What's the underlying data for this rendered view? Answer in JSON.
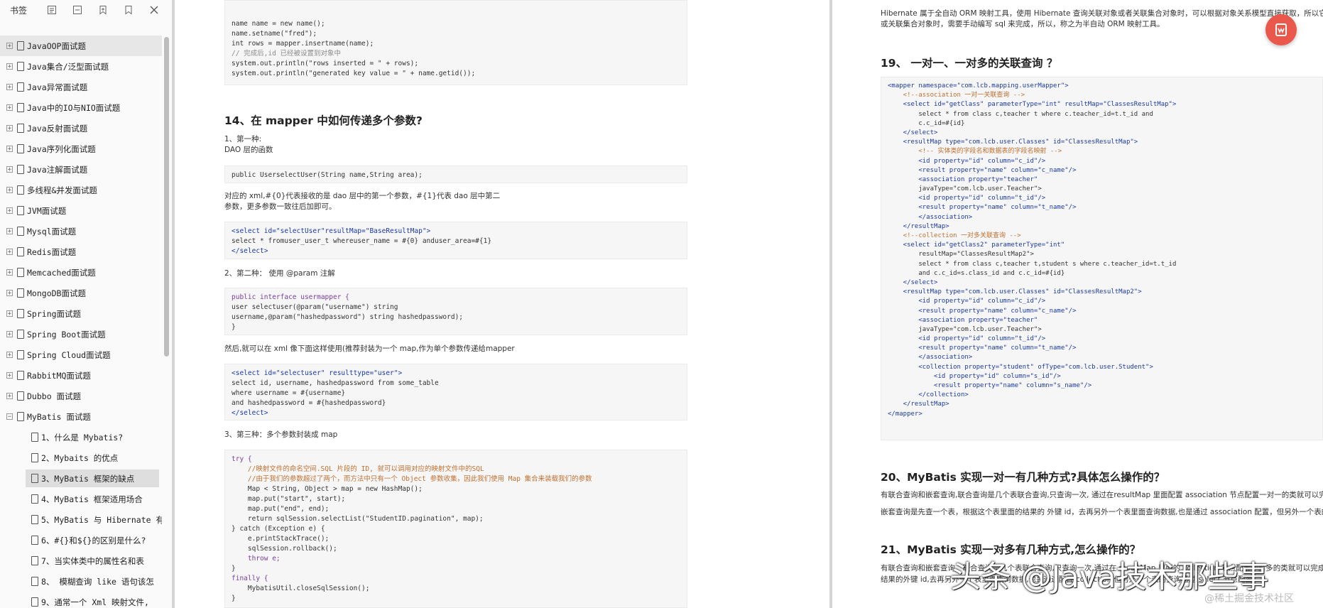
{
  "sidebar": {
    "title": "书签",
    "bookmarks": [
      "JavaOOP面试题",
      "Java集合/泛型面试题",
      "Java异常面试题",
      "Java中的IO与NIO面试题",
      "Java反射面试题",
      "Java序列化面试题",
      "Java注解面试题",
      "多线程&并发面试题",
      "JVM面试题",
      "Mysql面试题",
      "Redis面试题",
      "Memcached面试题",
      "MongoDB面试题",
      "Spring面试题",
      "Spring Boot面试题",
      "Spring Cloud面试题",
      "RabbitMQ面试题",
      "Dubbo 面试题",
      "MyBatis 面试题"
    ],
    "children": [
      "1、什么是 Mybatis?",
      "2、Mybaits 的优点",
      "3、MyBatis 框架的缺点",
      "4、MyBatis 框架适用场合",
      "5、MyBatis 与 Hibernate 有",
      "6、#{}和${}的区别是什么?",
      "7、当实体类中的属性名和表",
      "8、 模糊查询 like 语句该怎",
      "9、通常一个 Xml 映射文件,"
    ]
  },
  "page1": {
    "code_top": [
      "name name = new name();",
      "name.setname(\"fred\");",
      "int rows = mapper.insertname(name);",
      "// 完成后,id 已经被设置到对象中",
      "system.out.println(\"rows inserted = \" + rows);",
      "system.out.println(\"generated key value = \" + name.getid());"
    ],
    "heading14": "14、在 mapper 中如何传递多个参数?",
    "p_first": "1、第一种:",
    "p_dao": "DAO 层的函数",
    "code_dao": "public UserselectUser(String name,String area);",
    "p_explain1": "对应的 xml,#{0}代表接收的是 dao 层中的第一个参数，#{1}代表 dao 层中第二",
    "p_explain2": "参数，更多参数一致往后加即可。",
    "code_select1": [
      "<select id=\"selectUser\"resultMap=\"BaseResultMap\">",
      "select * fromuser_user_t whereuser_name = #{0} anduser_area=#{1}",
      "</select>"
    ],
    "p_second": "2、第二种： 使用 @param 注解",
    "code_interface": [
      "public interface usermapper {",
      "user selectuser(@param(\"username\") string",
      "username,@param(\"hashedpassword\") string hashedpassword);",
      "}"
    ],
    "p_then": "然后,就可以在 xml 像下面这样使用(推荐封装为一个 map,作为单个参数传递给mapper",
    "code_select2": [
      "<select id=\"selectuser\" resulttype=\"user\">",
      "select id, username, hashedpassword from some_table",
      "where username = #{username}",
      "and hashedpassword = #{hashedpassword}",
      "</select>"
    ],
    "p_third": "3、第三种：多个参数封装成 map",
    "code_try": [
      "try {",
      "    //映射文件的命名空间.SQL 片段的 ID, 就可以调用对应的映射文件中的SQL",
      "    //由于我们的参数超过了两个，而方法中只有一个 Object 参数收集，因此我们使用 Map 集合来装载我们的参数",
      "    Map < String, Object > map = new HashMap();",
      "    map.put(\"start\", start);",
      "    map.put(\"end\", end);",
      "    return sqlSession.selectList(\"StudentID.pagination\", map);",
      "} catch (Exception e) {",
      "    e.printStackTrace();",
      "    sqlSession.rollback();",
      "    throw e;",
      "}",
      "finally {",
      "    MybatisUtil.closeSqlSession();",
      "}"
    ]
  },
  "page2": {
    "p_top1": "Hibernate 属于全自动 ORM 映射工具，使用 Hibernate 查询关联对象或者关联集合对象时，可以根据对象关系模型直接获取，所以它是全",
    "p_top2": "或关联集合对象时，需要手动编写 sql 来完成，所以，称之为半自动 ORM 映射工具。",
    "heading19": "19、 一对一、一对多的关联查询 ？",
    "code_mapper": [
      "<mapper namespace=\"com.lcb.mapping.userMapper\">",
      "    <!--association 一对一关联查询 -->",
      "    <select id=\"getClass\" parameterType=\"int\" resultMap=\"ClassesResultMap\">",
      "        select * from class c,teacher t where c.teacher_id=t.t_id and",
      "        c.c_id=#{id}",
      "    </select>",
      "    <resultMap type=\"com.lcb.user.Classes\" id=\"ClassesResultMap\">",
      "        <!-- 实体类的字段名和数据表的字段名映射 -->",
      "        <id property=\"id\" column=\"c_id\"/>",
      "        <result property=\"name\" column=\"c_name\"/>",
      "        <association property=\"teacher\"",
      "        javaType=\"com.lcb.user.Teacher\">",
      "        <id property=\"id\" column=\"t_id\"/>",
      "        <result property=\"name\" column=\"t_name\"/>",
      "        </association>",
      "    </resultMap>",
      "    <!--collection 一对多关联查询 -->",
      "    <select id=\"getClass2\" parameterType=\"int\"",
      "        resultMap=\"ClassesResultMap2\">",
      "        select * from class c,teacher t,student s where c.teacher_id=t.t_id",
      "        and c.c_id=s.class_id and c.c_id=#{id}",
      "    </select>",
      "    <resultMap type=\"com.lcb.user.Classes\" id=\"ClassesResultMap2\">",
      "        <id property=\"id\" column=\"c_id\"/>",
      "        <result property=\"name\" column=\"c_name\"/>",
      "        <association property=\"teacher\"",
      "        javaType=\"com.lcb.user.Teacher\">",
      "        <id property=\"id\" column=\"t_id\"/>",
      "        <result property=\"name\" column=\"t_name\"/>",
      "        </association>",
      "        <collection property=\"student\" ofType=\"com.lcb.user.Student\">",
      "            <id property=\"id\" column=\"s_id\"/>",
      "            <result property=\"name\" column=\"s_name\"/>",
      "        </collection>",
      "    </resultMap>",
      "</mapper>"
    ],
    "heading20": "20、MyBatis 实现一对一有几种方式?具体怎么操作的？",
    "p20a": "有联合查询和嵌套查询,联合查询是几个表联合查询,只查询一次, 通过在resultMap 里面配置 association 节点配置一对一的类就可以完成；",
    "p20b": "嵌套查询是先查一个表，根据这个表里面的结果的 外键 id，去再另外一个表里面查询数据,也是通过 association 配置，但另外一个表的查询通",
    "heading21": "21、MyBatis 实现一对多有几种方式,怎么操作的？",
    "p21a": "有联合查询和嵌套查询。联合查询是几个表联合查询,只查询一次,通过在 resultMap 里面的 collection 节点配置一对多的类就可以完成；嵌套查",
    "p21b": "结果的外键 id,去再另外一个表里面查询数据,也是通过配置 collection,但另外一个表的查询通过 select 节点配置。"
  },
  "watermark": {
    "main": "头条 @Java技术那些事",
    "sub": "@稀土掘金技术社区"
  }
}
